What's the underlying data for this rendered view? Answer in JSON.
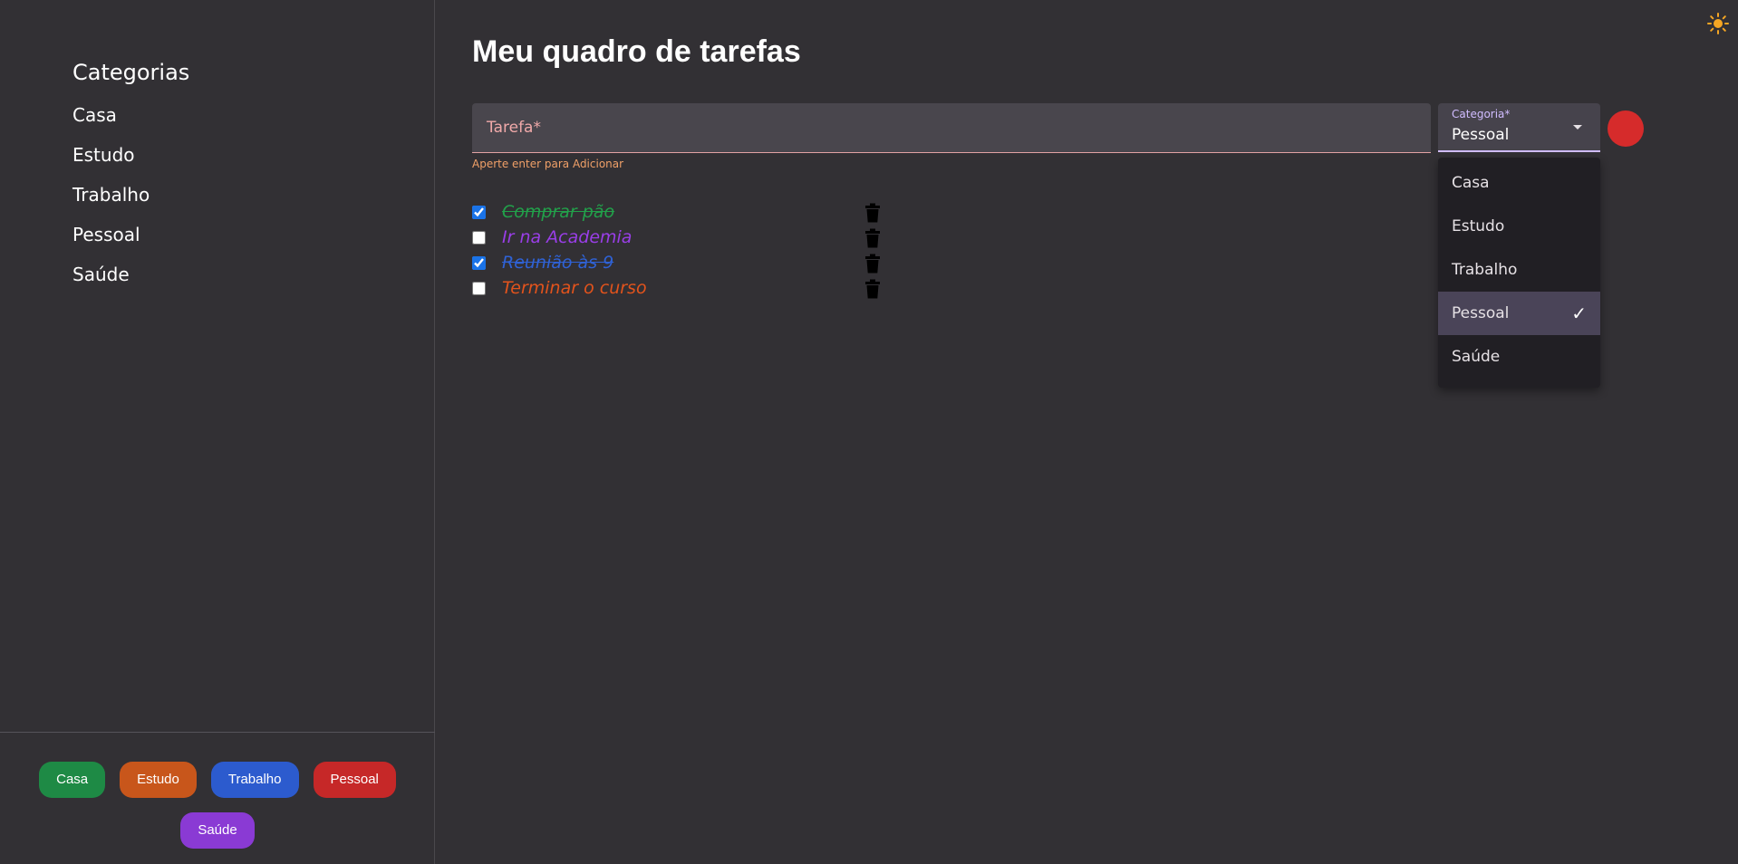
{
  "sidebar": {
    "title": "Categorias",
    "items": [
      {
        "label": "Casa"
      },
      {
        "label": "Estudo"
      },
      {
        "label": "Trabalho"
      },
      {
        "label": "Pessoal"
      },
      {
        "label": "Saúde"
      }
    ],
    "chips": [
      {
        "label": "Casa",
        "color": "#1e8a45"
      },
      {
        "label": "Estudo",
        "color": "#c8561b"
      },
      {
        "label": "Trabalho",
        "color": "#2c5bce"
      },
      {
        "label": "Pessoal",
        "color": "#c62828"
      },
      {
        "label": "Saúde",
        "color": "#8a3ad4"
      }
    ]
  },
  "main": {
    "title": "Meu quadro de tarefas",
    "task_input": {
      "placeholder": "Tarefa*",
      "helper": "Aperte enter para Adicionar"
    },
    "category_select": {
      "label": "Categoria*",
      "value": "Pessoal",
      "options": [
        "Casa",
        "Estudo",
        "Trabalho",
        "Pessoal",
        "Saúde"
      ],
      "selected_index": 3
    },
    "add_button_color": "#d62b2b",
    "theme_icon": "sun-icon",
    "tasks": [
      {
        "text": "Comprar pão",
        "done": true,
        "color": "#22a04a"
      },
      {
        "text": "Ir na Academia",
        "done": false,
        "color": "#9a3ee8"
      },
      {
        "text": "Reunião às 9",
        "done": true,
        "color": "#2f62d6"
      },
      {
        "text": "Terminar o curso",
        "done": false,
        "color": "#e2531c"
      }
    ]
  }
}
